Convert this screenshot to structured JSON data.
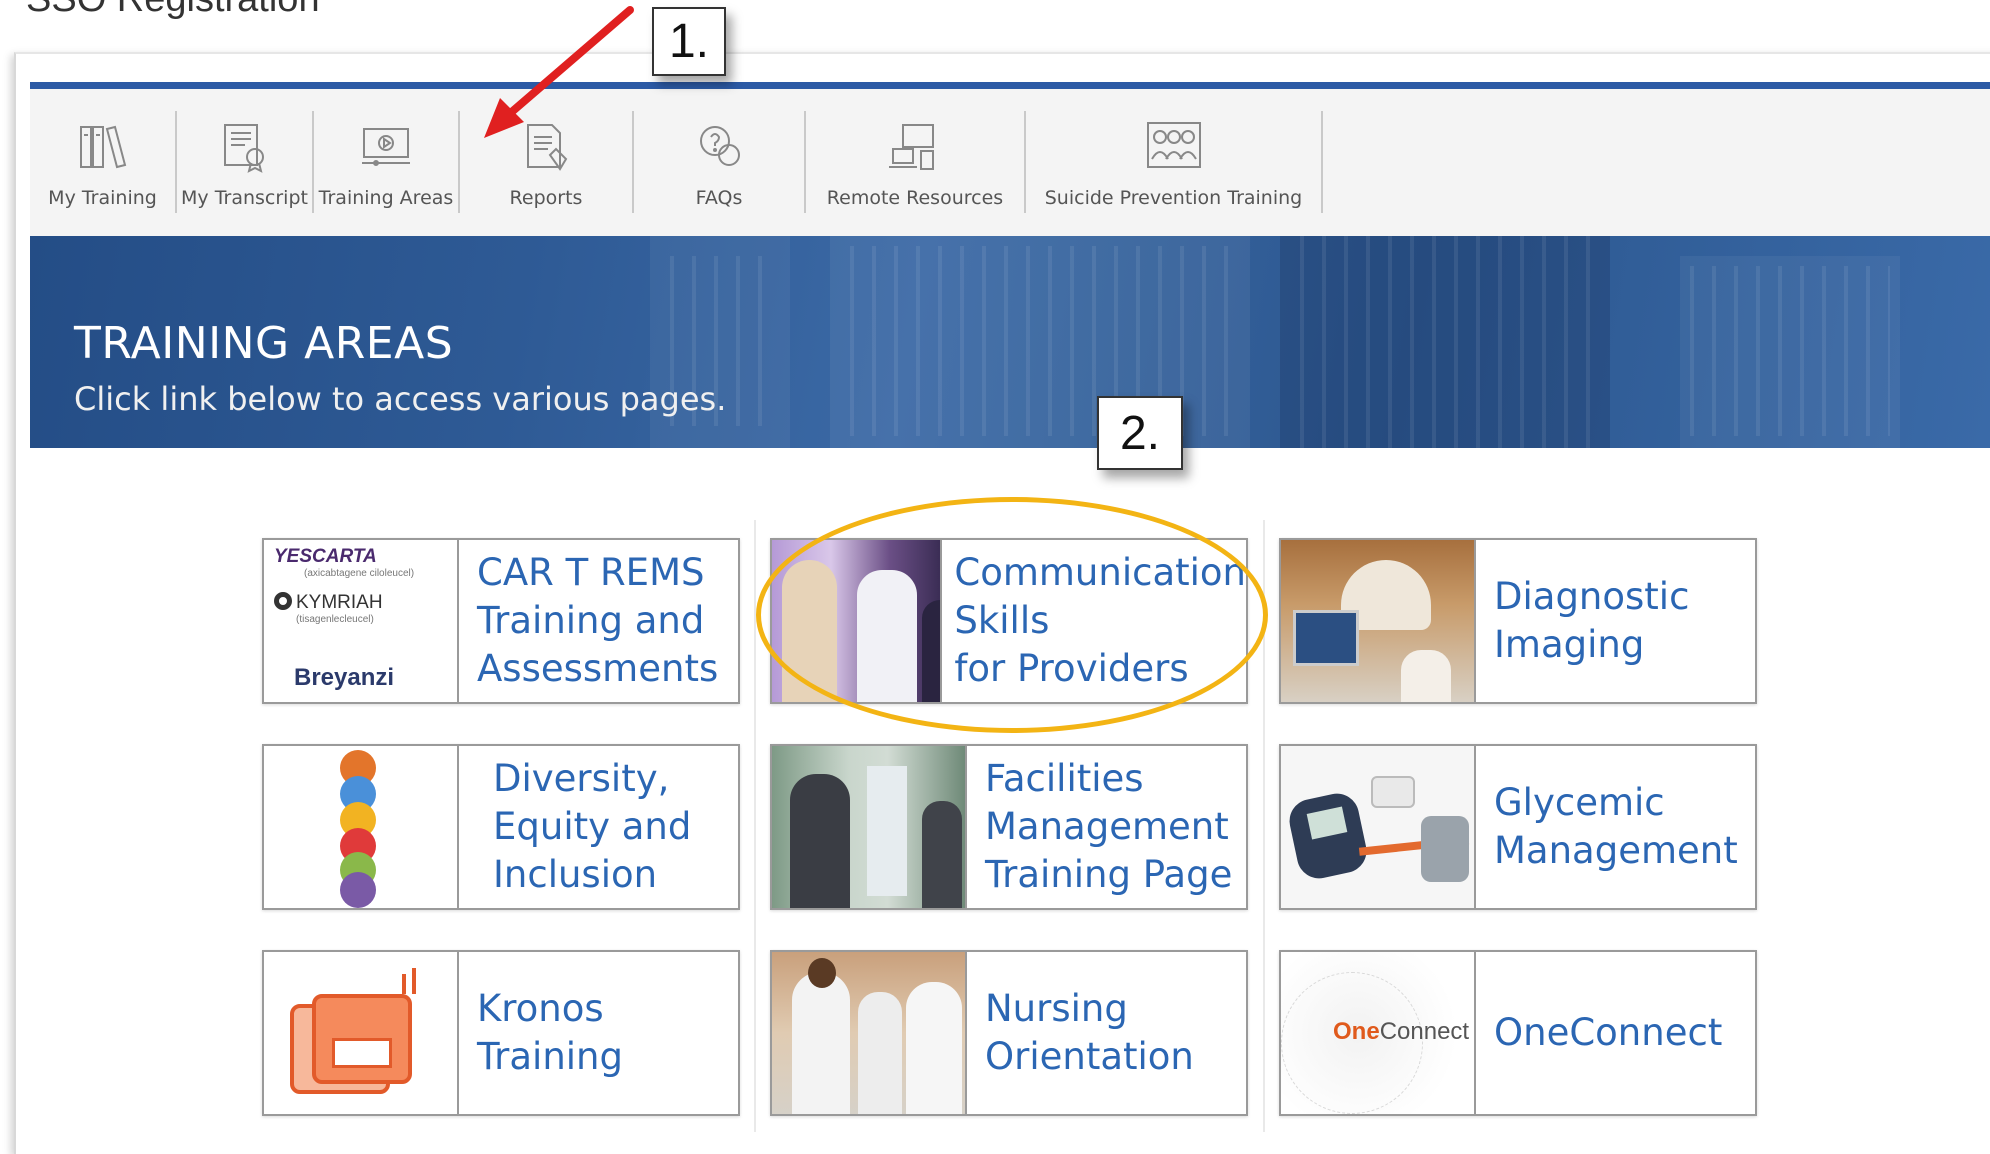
{
  "document": {
    "title": "SSO Registration"
  },
  "callouts": {
    "step1": "1.",
    "step2": "2."
  },
  "toolbar": {
    "items": [
      {
        "label": "My Training",
        "icon": "books-icon"
      },
      {
        "label": "My Transcript",
        "icon": "transcript-icon"
      },
      {
        "label": "Training Areas",
        "icon": "video-screen-icon"
      },
      {
        "label": "Reports",
        "icon": "report-icon"
      },
      {
        "label": "FAQs",
        "icon": "question-bubble-icon"
      },
      {
        "label": "Remote Resources",
        "icon": "remote-devices-icon"
      },
      {
        "label": "Suicide Prevention Training",
        "icon": "people-group-icon"
      }
    ]
  },
  "banner": {
    "title": "TRAINING AREAS",
    "subtitle": "Click link below to access various pages."
  },
  "tiles": [
    {
      "name": "CAR T REMS\nTraining and\nAssessments",
      "thumb_text": [
        "YESCARTA",
        "(axicabtagene ciloleucel)",
        "KYMRIAH",
        "(tisagenlecleucel)",
        "Breyanzi"
      ]
    },
    {
      "name": "Communication\nSkills\nfor Providers",
      "highlighted": true
    },
    {
      "name": "Diagnostic\nImaging"
    },
    {
      "name": "Diversity,\nEquity and\nInclusion"
    },
    {
      "name": "Facilities\nManagement\nTraining Page"
    },
    {
      "name": "Glycemic\nManagement"
    },
    {
      "name": "Kronos\nTraining"
    },
    {
      "name": "Nursing\nOrientation"
    },
    {
      "name": "OneConnect",
      "thumb_text": [
        "One",
        "Connect"
      ]
    }
  ],
  "colors": {
    "accent_blue": "#2c5aa5",
    "link_blue": "#2b66b3",
    "highlight": "#f3b414",
    "arrow_red": "#e02020"
  }
}
